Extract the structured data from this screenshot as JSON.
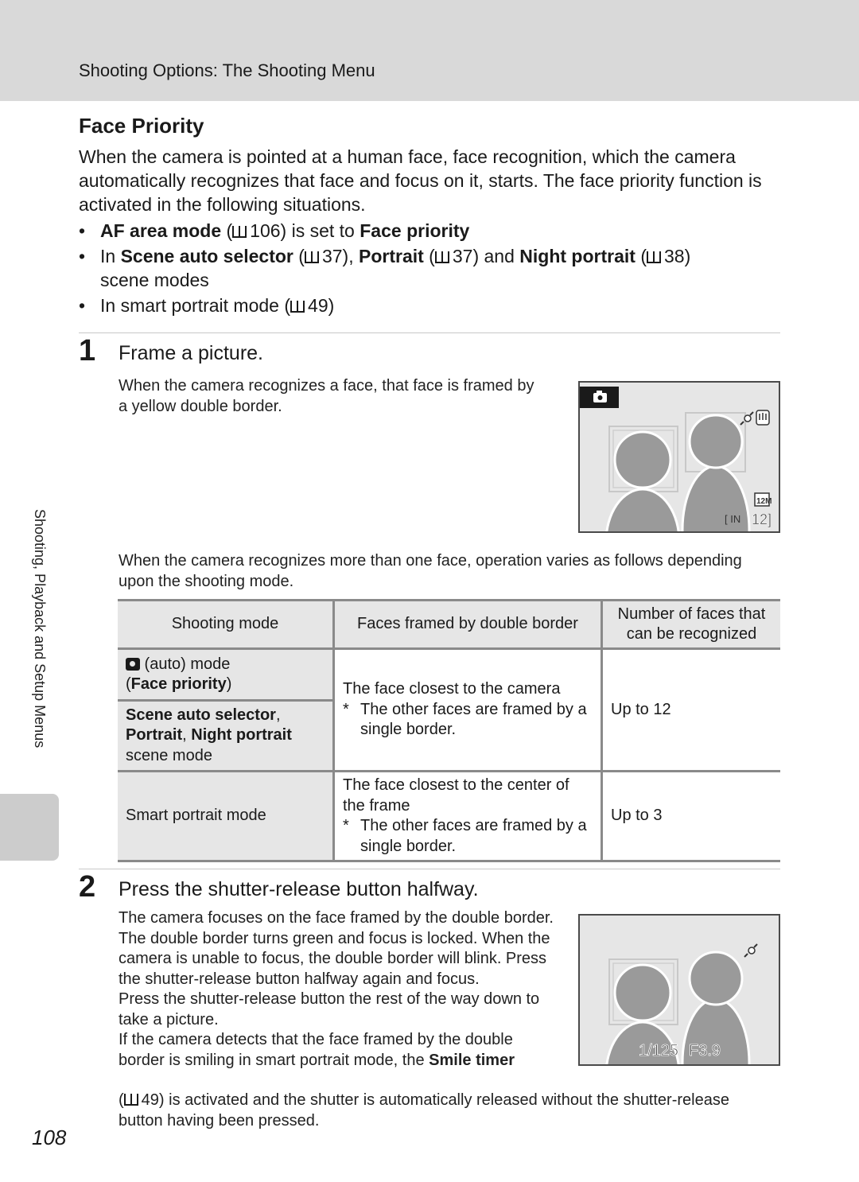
{
  "header": {
    "title": "Shooting Options: The Shooting Menu"
  },
  "section": {
    "title": "Face Priority",
    "intro": "When the camera is pointed at a human face, face recognition, which the camera automatically recognizes that face and focus on it, starts. The face priority function is activated in the following situations.",
    "bullets": [
      {
        "b1": "AF area mode",
        "t1": " (",
        "ref": "106",
        "t2": ") is set to ",
        "b2": "Face priority"
      },
      {
        "t0": "In ",
        "b1": "Scene auto selector",
        "ref1": "37",
        "b2": "Portrait",
        "ref2": "37",
        "t_and": ") and ",
        "b3": "Night portrait",
        "ref3": "38",
        "tail": "scene modes"
      },
      {
        "t0": "In smart portrait mode (",
        "ref": "49",
        "t1": ")"
      }
    ]
  },
  "side": {
    "label": "Shooting, Playback and Setup Menus"
  },
  "step1": {
    "number": "1",
    "title": "Frame a picture.",
    "body": "When the camera recognizes a face, that face is framed by a yellow double border.",
    "screen": {
      "mode_icon": "camera-auto-icon",
      "resolution": "12M",
      "memory": "IN",
      "remaining": "12"
    },
    "multi_face_text": "When the camera recognizes more than one face, operation varies as follows depending upon the shooting mode."
  },
  "table": {
    "headers": [
      "Shooting mode",
      "Faces framed by double border",
      "Number of faces that can be recognized"
    ],
    "rows": [
      {
        "mode_a_plain": " (auto) mode",
        "mode_a_bold": "Face priority",
        "mode_b_bold1": "Scene auto selector",
        "mode_b_bold2": "Portrait",
        "mode_b_bold3": "Night portrait",
        "mode_b_tail": "scene mode",
        "desc": "The face closest to the camera",
        "note": "The other faces are framed by a single border.",
        "count": "Up to 12"
      },
      {
        "mode": "Smart portrait mode",
        "desc": "The face closest to the center of the frame",
        "note": "The other faces are framed by a single border.",
        "count": "Up to 3"
      }
    ]
  },
  "step2": {
    "number": "2",
    "title": "Press the shutter-release button halfway.",
    "p1": "The camera focuses on the face framed by the double border. The double border turns green and focus is locked. When the camera is unable to focus, the double border will blink. Press the shutter-release button halfway again and focus.",
    "p2": "Press the shutter-release button the rest of the way down to take a picture.",
    "p3a": "If the camera detects that the face framed by the double border is smiling in smart portrait mode, the ",
    "p3b": "Smile timer",
    "p3c_ref": "49",
    "p3d": ") is activated and the shutter is automatically released without the shutter-release button having been pressed.",
    "screen": {
      "shutter_speed": "1/125",
      "aperture": "F3.9"
    }
  },
  "page_number": "108"
}
